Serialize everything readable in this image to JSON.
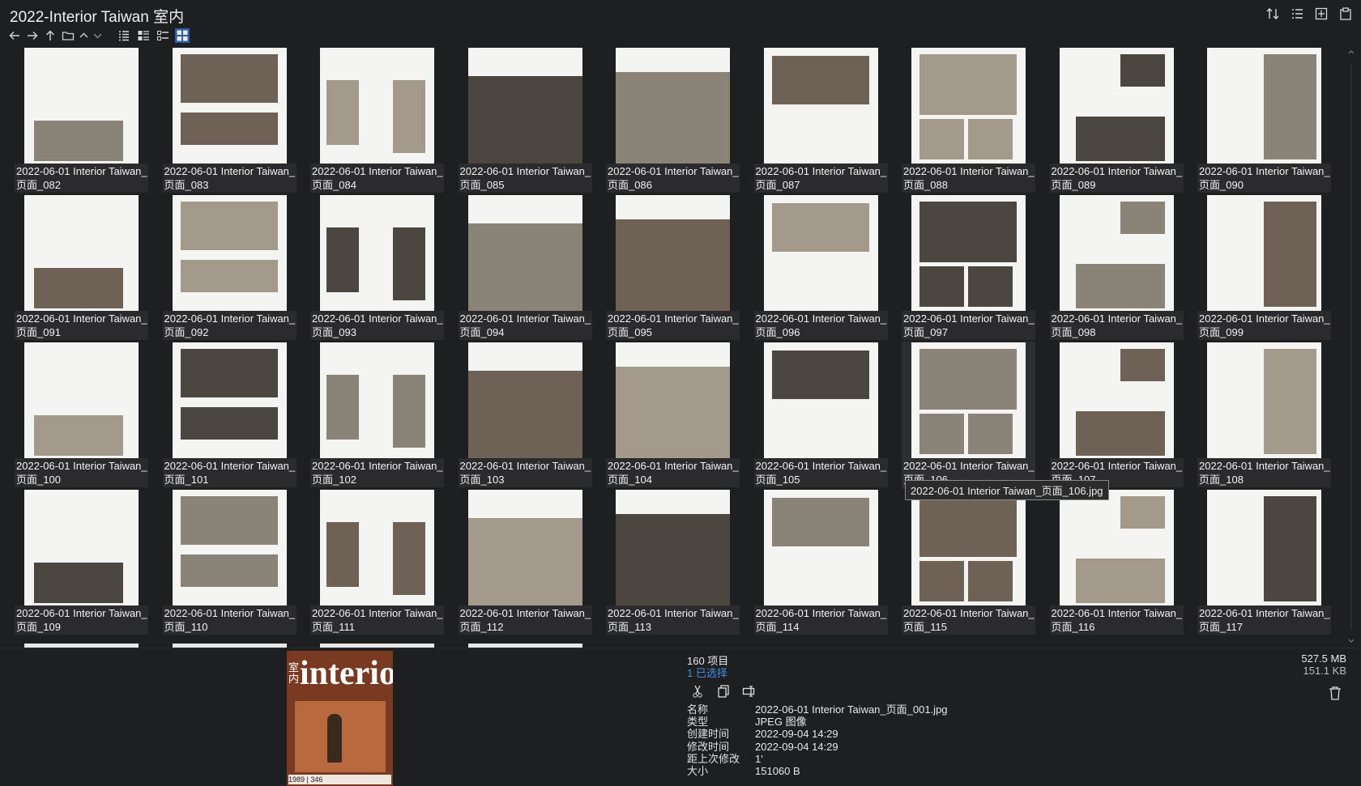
{
  "window": {
    "title": "2022-Interior Taiwan 室内"
  },
  "icons": {
    "title_bar": [
      "sort-icon",
      "details-icon",
      "add-panel-icon",
      "clipboard-icon"
    ],
    "nav": [
      "back-arrow-icon",
      "forward-arrow-icon",
      "up-arrow-icon",
      "folder-icon",
      "chevron-up-icon",
      "chevron-down-icon"
    ],
    "views": [
      "list-view-icon",
      "details-view-icon",
      "tiles-view-icon",
      "thumbnails-view-icon"
    ]
  },
  "files": [
    {
      "line1": "2022-06-01 Interior Taiwan_",
      "line2": "页面_082"
    },
    {
      "line1": "2022-06-01 Interior Taiwan_",
      "line2": "页面_083"
    },
    {
      "line1": "2022-06-01 Interior Taiwan_",
      "line2": "页面_084"
    },
    {
      "line1": "2022-06-01 Interior Taiwan_",
      "line2": "页面_085"
    },
    {
      "line1": "2022-06-01 Interior Taiwan_",
      "line2": "页面_086"
    },
    {
      "line1": "2022-06-01 Interior Taiwan_",
      "line2": "页面_087"
    },
    {
      "line1": "2022-06-01 Interior Taiwan_",
      "line2": "页面_088"
    },
    {
      "line1": "2022-06-01 Interior Taiwan_",
      "line2": "页面_089"
    },
    {
      "line1": "2022-06-01 Interior Taiwan_",
      "line2": "页面_090"
    },
    {
      "line1": "2022-06-01 Interior Taiwan_",
      "line2": "页面_091"
    },
    {
      "line1": "2022-06-01 Interior Taiwan_",
      "line2": "页面_092"
    },
    {
      "line1": "2022-06-01 Interior Taiwan_",
      "line2": "页面_093"
    },
    {
      "line1": "2022-06-01 Interior Taiwan_",
      "line2": "页面_094"
    },
    {
      "line1": "2022-06-01 Interior Taiwan_",
      "line2": "页面_095"
    },
    {
      "line1": "2022-06-01 Interior Taiwan_",
      "line2": "页面_096"
    },
    {
      "line1": "2022-06-01 Interior Taiwan_",
      "line2": "页面_097"
    },
    {
      "line1": "2022-06-01 Interior Taiwan_",
      "line2": "页面_098"
    },
    {
      "line1": "2022-06-01 Interior Taiwan_",
      "line2": "页面_099"
    },
    {
      "line1": "2022-06-01 Interior Taiwan_",
      "line2": "页面_100"
    },
    {
      "line1": "2022-06-01 Interior Taiwan_",
      "line2": "页面_101"
    },
    {
      "line1": "2022-06-01 Interior Taiwan_",
      "line2": "页面_102"
    },
    {
      "line1": "2022-06-01 Interior Taiwan_",
      "line2": "页面_103"
    },
    {
      "line1": "2022-06-01 Interior Taiwan_",
      "line2": "页面_104"
    },
    {
      "line1": "2022-06-01 Interior Taiwan_",
      "line2": "页面_105"
    },
    {
      "line1": "2022-06-01 Interior Taiwan_",
      "line2": "页面_106"
    },
    {
      "line1": "2022-06-01 Interior Taiwan_",
      "line2": "页面_107"
    },
    {
      "line1": "2022-06-01 Interior Taiwan_",
      "line2": "页面_108"
    },
    {
      "line1": "2022-06-01 Interior Taiwan_",
      "line2": "页面_109"
    },
    {
      "line1": "2022-06-01 Interior Taiwan_",
      "line2": "页面_110"
    },
    {
      "line1": "2022-06-01 Interior Taiwan_",
      "line2": "页面_111"
    },
    {
      "line1": "2022-06-01 Interior Taiwan_",
      "line2": "页面_112"
    },
    {
      "line1": "2022-06-01 Interior Taiwan_",
      "line2": "页面_113"
    },
    {
      "line1": "2022-06-01 Interior Taiwan_",
      "line2": "页面_114"
    },
    {
      "line1": "2022-06-01 Interior Taiwan_",
      "line2": "页面_115"
    },
    {
      "line1": "2022-06-01 Interior Taiwan_",
      "line2": "页面_116"
    },
    {
      "line1": "2022-06-01 Interior Taiwan_",
      "line2": "页面_117"
    }
  ],
  "hovered_index": 24,
  "tooltip": "2022-06-01 Interior Taiwan_页面_106.jpg",
  "status": {
    "item_count": "160 项目",
    "selected_count": "1 已选择",
    "total_size": "527.5 MB",
    "selected_size": "151.1 KB"
  },
  "preview": {
    "logo": "interior",
    "logo_cn": "室内",
    "issue": "1989 | 346"
  },
  "actions": [
    "cut-icon",
    "copy-icon",
    "rename-icon",
    "trash-icon"
  ],
  "properties": [
    {
      "key": "名称",
      "value": "2022-06-01 Interior Taiwan_页面_001.jpg"
    },
    {
      "key": "类型",
      "value": "JPEG 图像"
    },
    {
      "key": "创建时间",
      "value": "2022-09-04  14:29"
    },
    {
      "key": "修改时间",
      "value": "2022-09-04  14:29"
    },
    {
      "key": "距上次修改",
      "value": "1'"
    },
    {
      "key": "大小",
      "value": "151060 B"
    }
  ],
  "colors": {
    "background": "#1e1f21",
    "accent": "#2d5ea8",
    "selected_text": "#3e8fe0"
  }
}
